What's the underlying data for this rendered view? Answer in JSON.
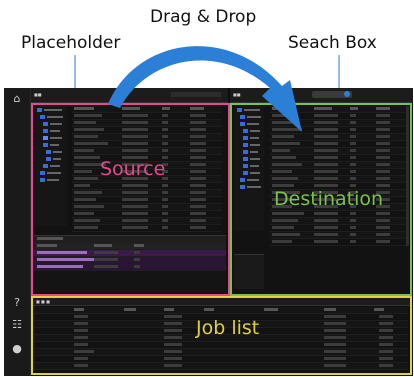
{
  "annotations": {
    "drag_drop": "Drag & Drop",
    "placeholder": "Placeholder",
    "search_box": "Seach Box"
  },
  "panels": {
    "source": "Source",
    "destination": "Destination",
    "job_list": "Job list"
  },
  "colors": {
    "source_frame": "#e34a8f",
    "destination_frame": "#79c24e",
    "joblist_frame": "#e0d23a",
    "arrow": "#2b7fd6"
  },
  "icons": [
    "home-icon",
    "help-icon",
    "settings-icon",
    "user-icon",
    "search-icon"
  ]
}
